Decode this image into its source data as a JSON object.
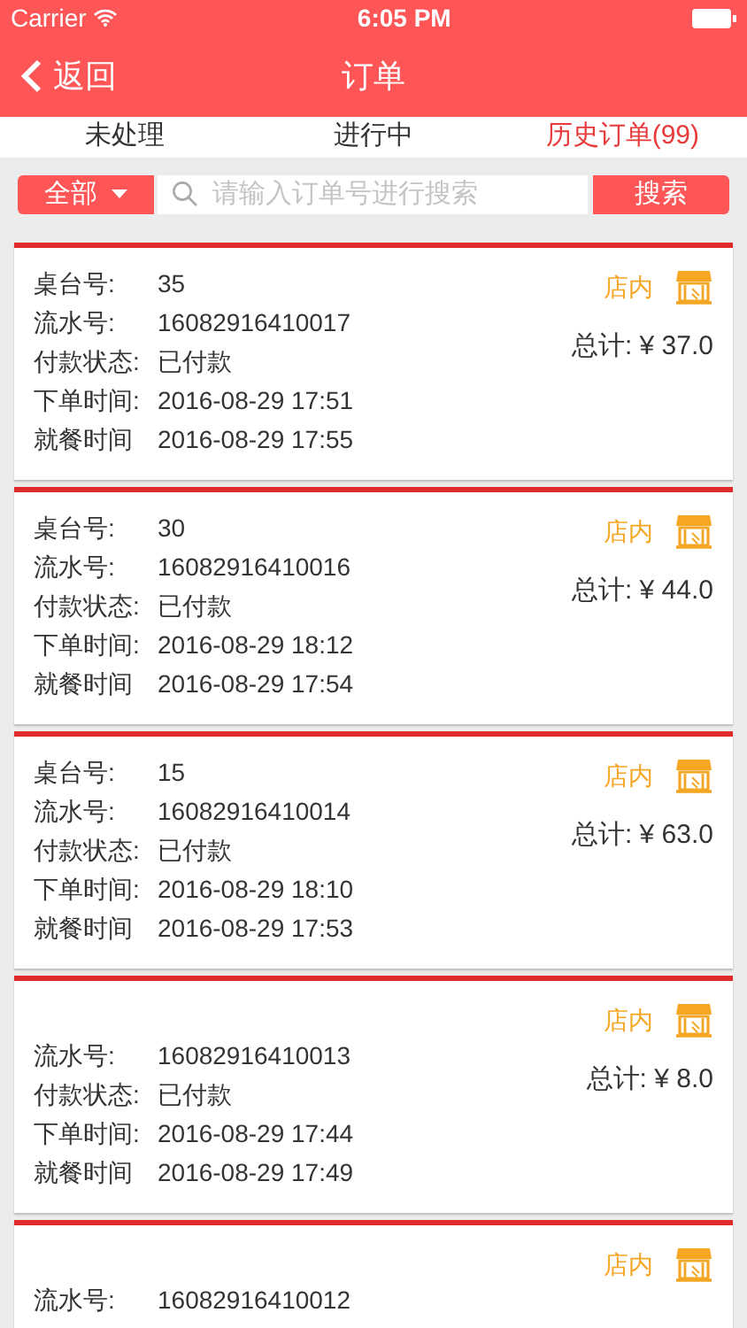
{
  "status_bar": {
    "carrier": "Carrier",
    "time": "6:05 PM"
  },
  "nav": {
    "back": "返回",
    "title": "订单"
  },
  "tabs": [
    {
      "label": "未处理",
      "selected": false
    },
    {
      "label": "进行中",
      "selected": false
    },
    {
      "label": "历史订单(99)",
      "selected": true
    }
  ],
  "search": {
    "filter": "全部",
    "placeholder": "请输入订单号进行搜索",
    "button": "搜索"
  },
  "orders": [
    {
      "table": {
        "label": "桌台号:",
        "value": "35"
      },
      "rows": [
        {
          "label": "流水号:",
          "value": "16082916410017"
        },
        {
          "label": "付款状态:",
          "value": "已付款"
        },
        {
          "label": "下单时间:",
          "value": "2016-08-29 17:51"
        },
        {
          "label": "就餐时间",
          "value": "2016-08-29 17:55"
        }
      ],
      "type": "店内",
      "total": "总计: ¥ 37.0"
    },
    {
      "table": {
        "label": "桌台号:",
        "value": "30"
      },
      "rows": [
        {
          "label": "流水号:",
          "value": "16082916410016"
        },
        {
          "label": "付款状态:",
          "value": "已付款"
        },
        {
          "label": "下单时间:",
          "value": "2016-08-29 18:12"
        },
        {
          "label": "就餐时间",
          "value": "2016-08-29 17:54"
        }
      ],
      "type": "店内",
      "total": "总计: ¥ 44.0"
    },
    {
      "table": {
        "label": "桌台号:",
        "value": "15"
      },
      "rows": [
        {
          "label": "流水号:",
          "value": "16082916410014"
        },
        {
          "label": "付款状态:",
          "value": "已付款"
        },
        {
          "label": "下单时间:",
          "value": "2016-08-29 18:10"
        },
        {
          "label": "就餐时间",
          "value": "2016-08-29 17:53"
        }
      ],
      "type": "店内",
      "total": "总计: ¥ 63.0"
    },
    {
      "rows": [
        {
          "label": "流水号:",
          "value": "16082916410013"
        },
        {
          "label": "付款状态:",
          "value": "已付款"
        },
        {
          "label": "下单时间:",
          "value": "2016-08-29 17:44"
        },
        {
          "label": "就餐时间",
          "value": "2016-08-29 17:49"
        }
      ],
      "type": "店内",
      "total": "总计: ¥ 8.0"
    },
    {
      "rows": [
        {
          "label": "流水号:",
          "value": "16082916410012"
        }
      ],
      "type": "店内"
    }
  ]
}
